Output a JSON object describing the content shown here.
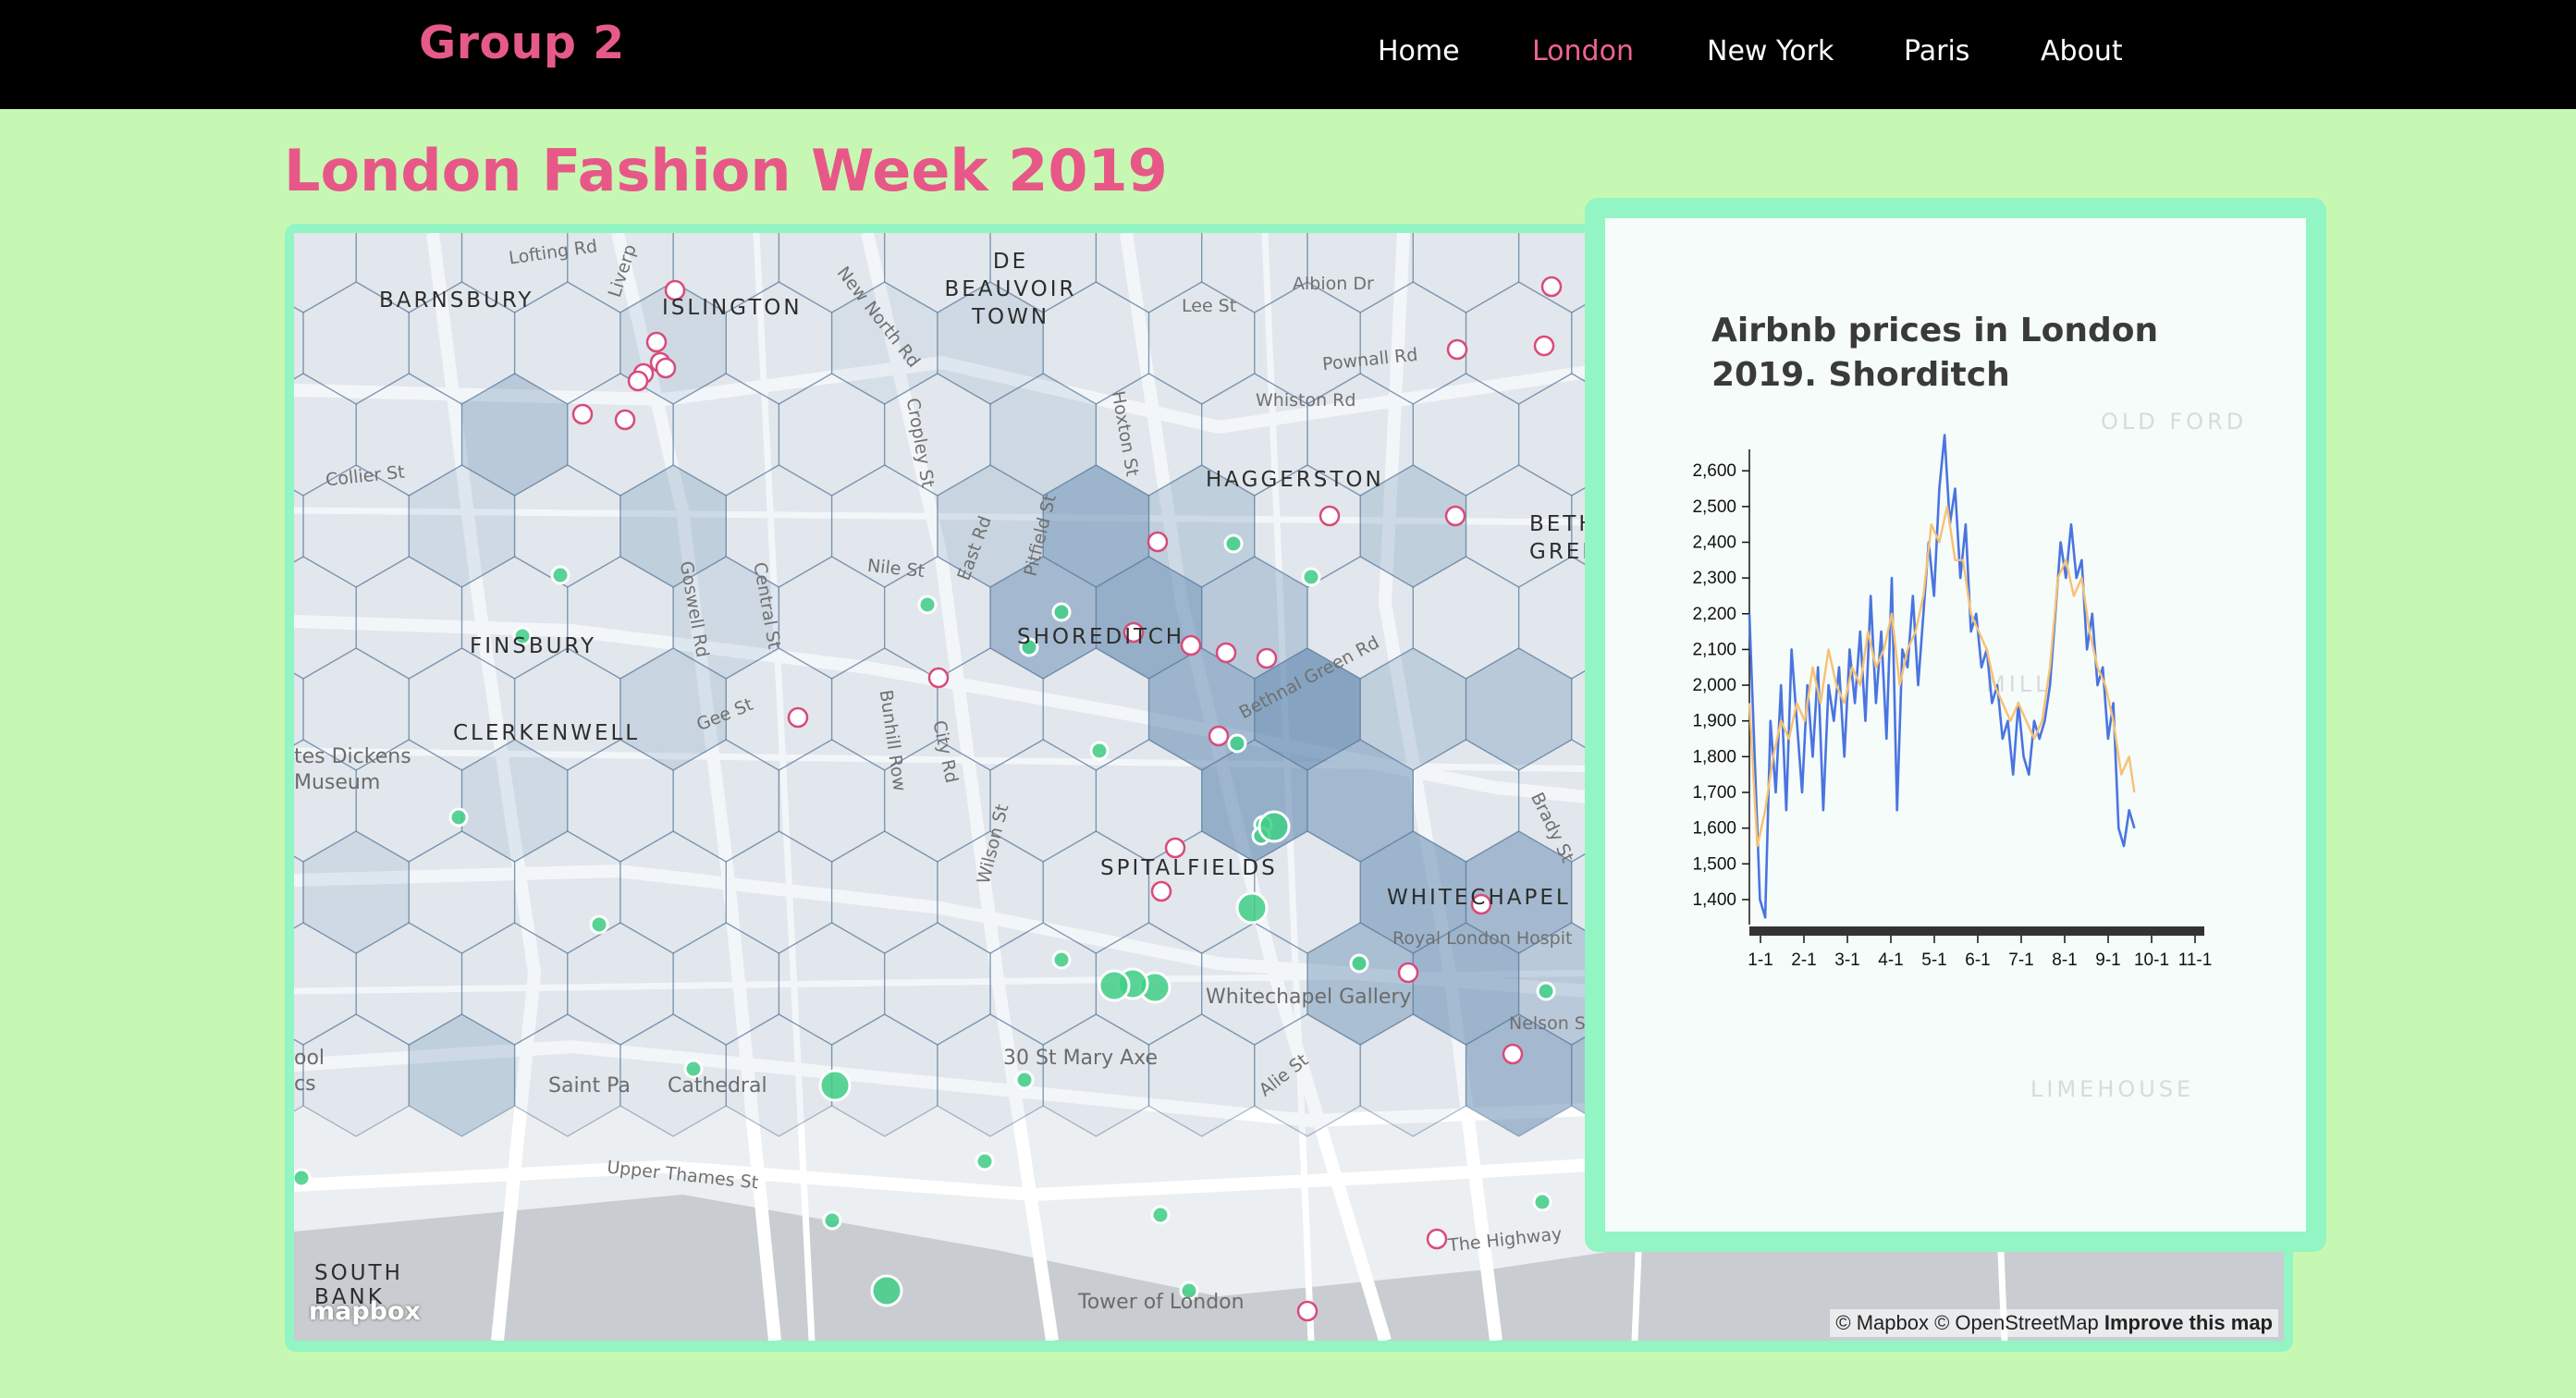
{
  "nav": {
    "brand": "Group 2",
    "links": [
      {
        "label": "Home",
        "active": false
      },
      {
        "label": "London",
        "active": true
      },
      {
        "label": "New York",
        "active": false
      },
      {
        "label": "Paris",
        "active": false
      },
      {
        "label": "About",
        "active": false
      }
    ]
  },
  "page": {
    "title": "London Fashion Week 2019"
  },
  "map": {
    "area_labels": [
      "BARNSBURY",
      "ISLINGTON",
      "DE BEAUVOIR TOWN",
      "HAGGERSTON",
      "FINSBURY",
      "CLERKENWELL",
      "SHOREDITCH",
      "SPITALFIELDS",
      "WHITECHAPEL",
      "SOUTH BANK",
      "BETHNAL GREEN"
    ],
    "street_labels": [
      "Lofting Rd",
      "Liverp",
      "New North Rd",
      "Lee St",
      "Albion Dr",
      "Pownall Rd",
      "Whiston Rd",
      "Collier St",
      "Cropley St",
      "Hoxton St",
      "Nile St",
      "East Rd",
      "Pitfield St",
      "Goswell Rd",
      "Central St",
      "Gee St",
      "Bunhill Row",
      "City Rd",
      "Bethnal Green Rd",
      "Wilson St",
      "Brady St",
      "Royal London Hospit",
      "Nelson S",
      "Alie St",
      "Upper Thames St",
      "The Highway"
    ],
    "poi_labels": [
      "tes Dickens",
      "Museum",
      "Whitechapel Gallery",
      "30 St Mary Axe",
      "Saint Pa",
      "Cathedral",
      "ool",
      "cs",
      "Tower of London"
    ],
    "logo": "mapbox",
    "attribution": "© Mapbox © OpenStreetMap",
    "improve_link": "Improve this map",
    "colors": {
      "hex_fill": "#5b84ad",
      "hex_stroke": "#4d6f94",
      "pink_marker": "#d94a7a",
      "green_marker": "#3fcf86"
    }
  },
  "chart_panel": {
    "title": "Airbnb prices in London 2019. Shorditch",
    "background_labels": [
      "OLD FORD",
      "LIMEHOUSE",
      "MILL"
    ]
  },
  "chart_data": {
    "type": "line",
    "title": "Airbnb prices in London 2019. Shorditch",
    "xlabel": "",
    "ylabel": "",
    "x_ticks": [
      "1-1",
      "2-1",
      "3-1",
      "4-1",
      "5-1",
      "6-1",
      "7-1",
      "8-1",
      "9-1",
      "10-1",
      "11-1"
    ],
    "y_ticks": [
      1400,
      1500,
      1600,
      1700,
      1800,
      1900,
      2000,
      2100,
      2200,
      2300,
      2400,
      2500,
      2600
    ],
    "ylim": [
      1330,
      2660
    ],
    "xlim_days": [
      0,
      345
    ],
    "series": [
      {
        "color": "#4a74e0",
        "points": [
          [
            0,
            2200
          ],
          [
            4,
            1800
          ],
          [
            8,
            1400
          ],
          [
            12,
            1350
          ],
          [
            16,
            1900
          ],
          [
            20,
            1700
          ],
          [
            24,
            2000
          ],
          [
            28,
            1650
          ],
          [
            32,
            2100
          ],
          [
            36,
            1900
          ],
          [
            40,
            1700
          ],
          [
            44,
            2000
          ],
          [
            48,
            1800
          ],
          [
            52,
            2050
          ],
          [
            56,
            1650
          ],
          [
            60,
            2000
          ],
          [
            64,
            1900
          ],
          [
            68,
            2050
          ],
          [
            72,
            1800
          ],
          [
            76,
            2100
          ],
          [
            80,
            1950
          ],
          [
            84,
            2150
          ],
          [
            88,
            1900
          ],
          [
            92,
            2250
          ],
          [
            96,
            1950
          ],
          [
            100,
            2150
          ],
          [
            104,
            1850
          ],
          [
            108,
            2300
          ],
          [
            112,
            1650
          ],
          [
            116,
            2100
          ],
          [
            120,
            2050
          ],
          [
            124,
            2250
          ],
          [
            128,
            2000
          ],
          [
            132,
            2200
          ],
          [
            136,
            2400
          ],
          [
            140,
            2250
          ],
          [
            144,
            2550
          ],
          [
            148,
            2700
          ],
          [
            152,
            2450
          ],
          [
            156,
            2550
          ],
          [
            160,
            2300
          ],
          [
            164,
            2450
          ],
          [
            168,
            2150
          ],
          [
            172,
            2200
          ],
          [
            176,
            2050
          ],
          [
            180,
            2100
          ],
          [
            184,
            1950
          ],
          [
            188,
            2000
          ],
          [
            192,
            1850
          ],
          [
            196,
            1900
          ],
          [
            200,
            1750
          ],
          [
            204,
            1950
          ],
          [
            208,
            1800
          ],
          [
            212,
            1750
          ],
          [
            216,
            1900
          ],
          [
            220,
            1850
          ],
          [
            224,
            1900
          ],
          [
            228,
            2000
          ],
          [
            232,
            2200
          ],
          [
            236,
            2400
          ],
          [
            240,
            2300
          ],
          [
            244,
            2450
          ],
          [
            248,
            2300
          ],
          [
            252,
            2350
          ],
          [
            256,
            2100
          ],
          [
            260,
            2200
          ],
          [
            264,
            2000
          ],
          [
            268,
            2050
          ],
          [
            272,
            1850
          ],
          [
            276,
            1950
          ],
          [
            280,
            1600
          ],
          [
            284,
            1550
          ],
          [
            288,
            1650
          ],
          [
            292,
            1600
          ]
        ]
      },
      {
        "color": "#f7c173",
        "points": [
          [
            0,
            1950
          ],
          [
            6,
            1550
          ],
          [
            12,
            1650
          ],
          [
            18,
            1800
          ],
          [
            24,
            1900
          ],
          [
            30,
            1850
          ],
          [
            36,
            1950
          ],
          [
            42,
            1900
          ],
          [
            48,
            2050
          ],
          [
            54,
            1950
          ],
          [
            60,
            2100
          ],
          [
            66,
            2000
          ],
          [
            72,
            1950
          ],
          [
            78,
            2050
          ],
          [
            84,
            2000
          ],
          [
            90,
            2150
          ],
          [
            96,
            2050
          ],
          [
            102,
            2100
          ],
          [
            108,
            2200
          ],
          [
            114,
            2000
          ],
          [
            120,
            2100
          ],
          [
            126,
            2150
          ],
          [
            132,
            2250
          ],
          [
            138,
            2450
          ],
          [
            144,
            2400
          ],
          [
            150,
            2500
          ],
          [
            156,
            2350
          ],
          [
            162,
            2350
          ],
          [
            168,
            2200
          ],
          [
            174,
            2150
          ],
          [
            180,
            2100
          ],
          [
            186,
            2000
          ],
          [
            192,
            1950
          ],
          [
            198,
            1900
          ],
          [
            204,
            1950
          ],
          [
            210,
            1900
          ],
          [
            216,
            1850
          ],
          [
            222,
            1900
          ],
          [
            228,
            2050
          ],
          [
            234,
            2300
          ],
          [
            240,
            2350
          ],
          [
            246,
            2250
          ],
          [
            252,
            2300
          ],
          [
            258,
            2150
          ],
          [
            264,
            2050
          ],
          [
            270,
            2000
          ],
          [
            276,
            1900
          ],
          [
            282,
            1750
          ],
          [
            288,
            1800
          ],
          [
            292,
            1700
          ]
        ]
      }
    ]
  }
}
